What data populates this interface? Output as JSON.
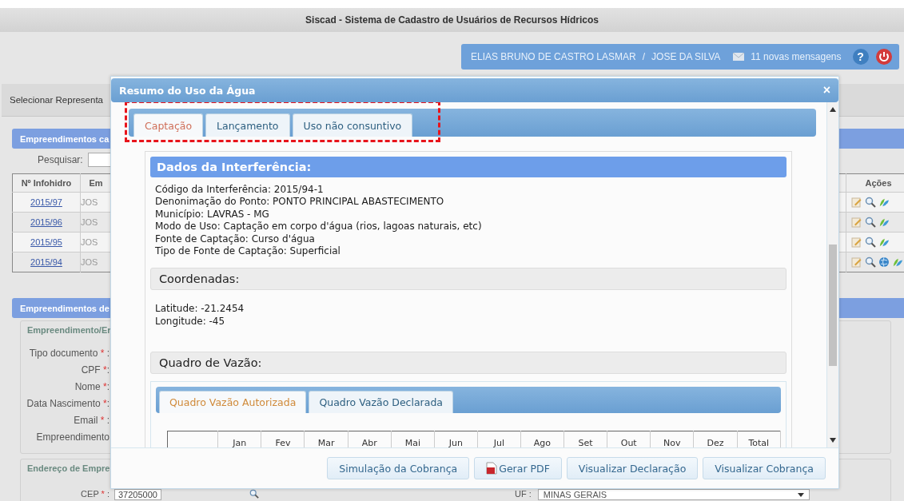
{
  "app_title": "Siscad - Sistema de Cadastro de Usuários de Recursos Hídricos",
  "user_bar": {
    "user": "ELIAS BRUNO DE CASTRO LASMAR",
    "separator": "/",
    "representative": "JOSE DA SILVA",
    "messages": "11 novas mensagens",
    "help": "?"
  },
  "tab_strip": {
    "label": "Selecionar Representa"
  },
  "list_section": {
    "title": "Empreendimentos ca",
    "search_label": "Pesquisar:",
    "columns": [
      "Nº Infohidro",
      "Em",
      "Ações"
    ],
    "rows": [
      {
        "number": "2015/97",
        "name": "JOS",
        "actions": [
          {
            "kind": "edit"
          },
          {
            "kind": "search"
          },
          {
            "kind": "plant"
          }
        ]
      },
      {
        "number": "2015/96",
        "name": "JOS",
        "actions": [
          {
            "kind": "edit"
          },
          {
            "kind": "search"
          },
          {
            "kind": "plant"
          }
        ]
      },
      {
        "number": "2015/95",
        "name": "JOS",
        "actions": [
          {
            "kind": "edit"
          },
          {
            "kind": "search"
          },
          {
            "kind": "plant"
          }
        ]
      },
      {
        "number": "2015/94",
        "name": "JOS",
        "actions": [
          {
            "kind": "edit"
          },
          {
            "kind": "search"
          },
          {
            "kind": "globe"
          },
          {
            "kind": "plant"
          }
        ]
      }
    ]
  },
  "form_section": {
    "title": "Empreendimentos de",
    "group_title": "Empreendimento/Er",
    "fields": [
      {
        "label": "Tipo documento",
        "mark": "*",
        "tail": " :"
      },
      {
        "label": "CPF",
        "mark": "*",
        "tail": ":"
      },
      {
        "label": "Nome",
        "mark": "*",
        "tail": ":"
      },
      {
        "label": "Data Nascimento",
        "mark": "*",
        "tail": ":"
      },
      {
        "label": "Email",
        "mark": "*",
        "tail": " :"
      },
      {
        "label": "Empreendimento"
      }
    ]
  },
  "address_section": {
    "title": "Endereço de Empre",
    "cep_label": "CEP",
    "cep_mark": "*",
    "cep_tail": " :",
    "cep_value": "37205000",
    "uf_label": "UF :",
    "uf_value": "MINAS GERAIS"
  },
  "modal": {
    "title": "Resumo do Uso da Água",
    "close": "×",
    "tabs": [
      {
        "label": "Captação",
        "selected": true
      },
      {
        "label": "Lançamento",
        "selected": false
      },
      {
        "label": "Uso não consuntivo",
        "selected": false
      }
    ],
    "interference": {
      "title": "Dados da Interferência:",
      "lines": [
        "Código da Interferência: 2015/94-1",
        "Denonimação do Ponto: PONTO PRINCIPAL ABASTECIMENTO",
        "Município: LAVRAS - MG",
        "Modo de Uso: Captação em corpo d'água (rios, lagoas naturais, etc)",
        "Fonte de Captação: Curso d'água",
        "Tipo de Fonte de Captação: Superficial"
      ]
    },
    "coordinates": {
      "title": "Coordenadas:",
      "lines": [
        "Latitude: -21.2454",
        "Longitude: -45"
      ]
    },
    "flow": {
      "title": "Quadro de Vazão:",
      "tabs": [
        {
          "label": "Quadro Vazão Autorizada",
          "selected": true
        },
        {
          "label": "Quadro Vazão Declarada",
          "selected": false
        }
      ],
      "columns": [
        "Jan",
        "Fev",
        "Mar",
        "Abr",
        "Mai",
        "Jun",
        "Jul",
        "Ago",
        "Set",
        "Out",
        "Nov",
        "Dez",
        "Total"
      ]
    },
    "buttons": [
      {
        "label": "Simulação da Cobrança",
        "kind": "plain"
      },
      {
        "label": "Gerar PDF",
        "kind": "pdf"
      },
      {
        "label": "Visualizar Declaração",
        "kind": "plain"
      },
      {
        "label": "Visualizar Cobrança",
        "kind": "plain"
      }
    ]
  }
}
